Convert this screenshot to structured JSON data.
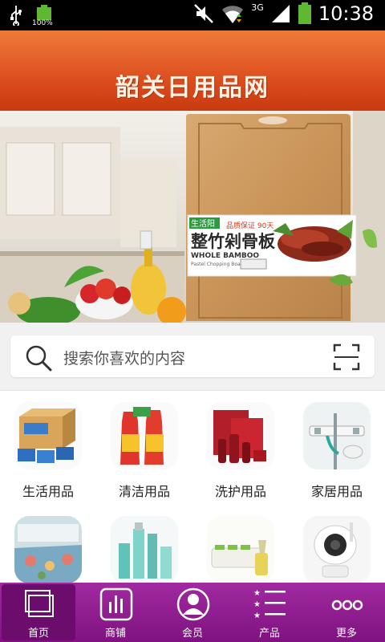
{
  "status": {
    "battery_percent_label": "100%",
    "network_label": "3G",
    "time": "10:38"
  },
  "header": {
    "title": "韶关日用品网"
  },
  "banner": {
    "product_brand": "生活阳",
    "product_tagline": "品质保证 90天",
    "product_name": "整竹剁骨板",
    "product_name_en": "WHOLE BAMBOO",
    "product_sub_en": "Pastel Chopping Board",
    "slide_count": 5,
    "active_slide": 5
  },
  "search": {
    "placeholder": "搜索你喜欢的内容"
  },
  "categories": [
    {
      "label": "生活用品",
      "icon": "paper-towel-box-icon"
    },
    {
      "label": "清洁用品",
      "icon": "cleaner-bottles-icon"
    },
    {
      "label": "洗护用品",
      "icon": "skincare-set-icon"
    },
    {
      "label": "家居用品",
      "icon": "wall-hook-icon"
    },
    {
      "label": "",
      "icon": "bedding-icon"
    },
    {
      "label": "",
      "icon": "cosmetics-bottles-icon"
    },
    {
      "label": "",
      "icon": "spice-jars-icon"
    },
    {
      "label": "",
      "icon": "security-camera-icon"
    }
  ],
  "tabs": [
    {
      "label": "首页",
      "icon": "home-icon",
      "active": true
    },
    {
      "label": "商铺",
      "icon": "shop-chart-icon",
      "active": false
    },
    {
      "label": "会员",
      "icon": "member-icon",
      "active": false
    },
    {
      "label": "产品",
      "icon": "product-list-icon",
      "active": false
    },
    {
      "label": "更多",
      "icon": "more-dots-icon",
      "active": false
    }
  ],
  "colors": {
    "header": "#e05a24",
    "tabbar": "#8e1c8f",
    "battery": "#5fb832"
  }
}
